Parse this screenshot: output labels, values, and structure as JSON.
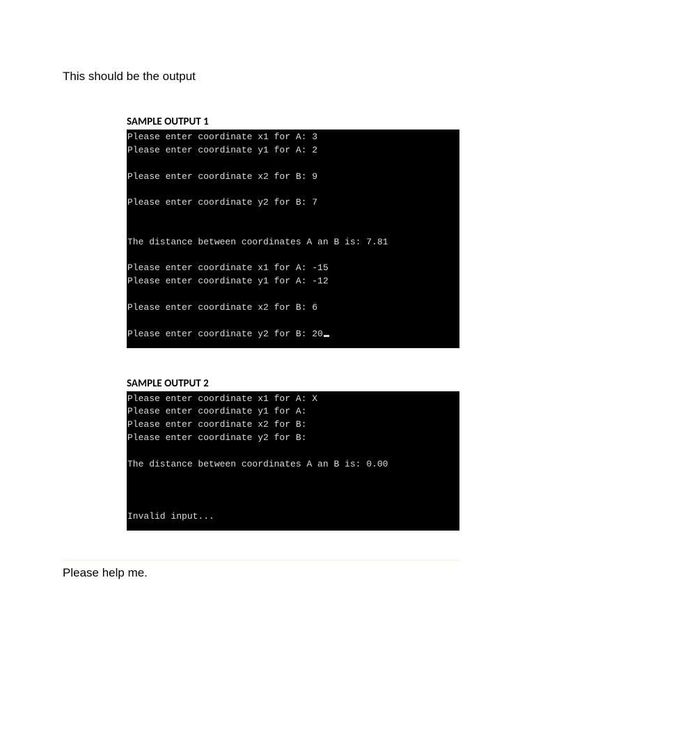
{
  "intro": "This should be the output",
  "sample1": {
    "heading": "SAMPLE OUTPUT 1",
    "lines": [
      "Please enter coordinate x1 for A: 3",
      "Please enter coordinate y1 for A: 2",
      "",
      "Please enter coordinate x2 for B: 9",
      "",
      "Please enter coordinate y2 for B: 7",
      "",
      "",
      "The distance between coordinates A an B is: 7.81",
      "",
      "Please enter coordinate x1 for A: -15",
      "Please enter coordinate y1 for A: -12",
      "",
      "Please enter coordinate x2 for B: 6",
      "",
      "Please enter coordinate y2 for B: 20"
    ],
    "cursor_after_last": true
  },
  "sample2": {
    "heading": "SAMPLE OUTPUT 2",
    "lines": [
      "Please enter coordinate x1 for A: X",
      "Please enter coordinate y1 for A:",
      "Please enter coordinate x2 for B:",
      "Please enter coordinate y2 for B:",
      "",
      "The distance between coordinates A an B is: 0.00",
      "",
      "",
      "",
      "Invalid input..."
    ],
    "cursor_after_last": false
  },
  "closing": "Please help me."
}
